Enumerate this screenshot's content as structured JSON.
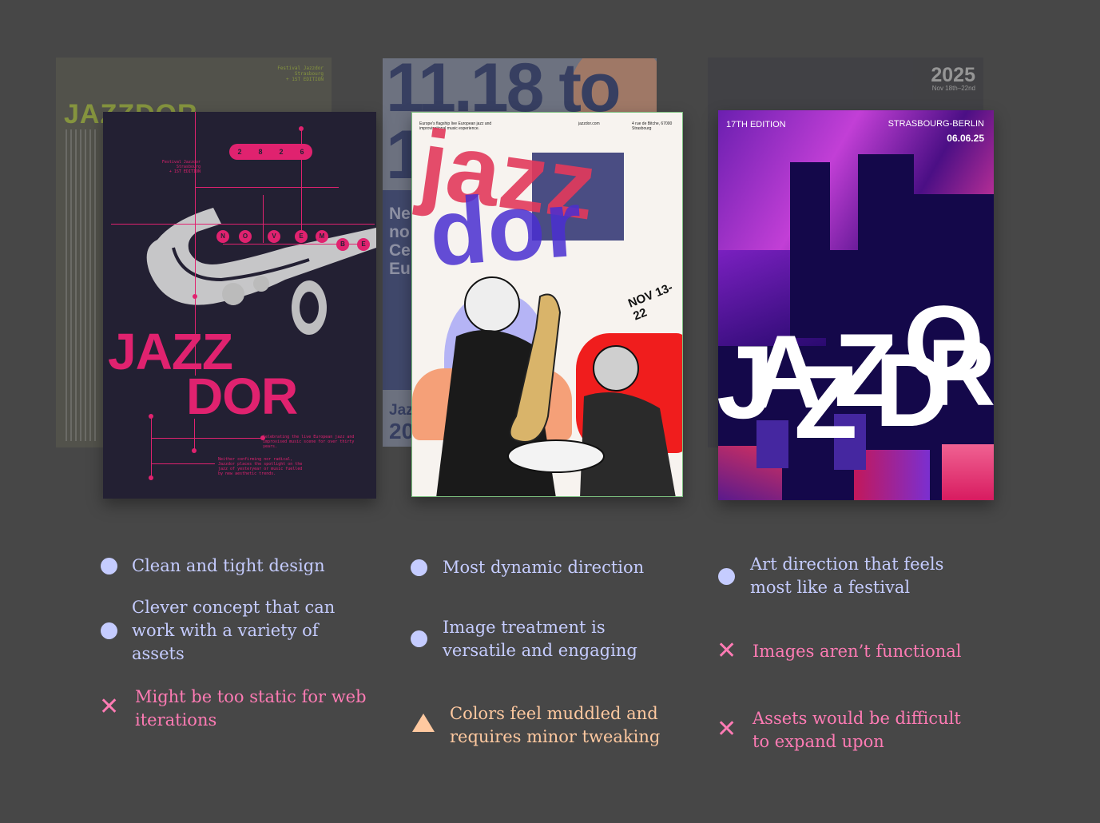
{
  "posters": {
    "back1": {
      "title": "JAZZDOR",
      "tag_lines": [
        "Festival Jazzdor",
        "Strasbourg",
        "+ 1ST EDITION"
      ]
    },
    "back2": {
      "big_date": "11.18 to",
      "big_num": "1",
      "side_text": [
        "Ne",
        "no",
        "Ce",
        "Eu"
      ],
      "bottom_text": [
        "Jaz",
        "20"
      ]
    },
    "back3": {
      "year": "2025",
      "dates": "Nov 18th–22nd"
    },
    "poster1": {
      "numbers": [
        "2",
        "8",
        "2",
        "6"
      ],
      "tag_lines": [
        "Festival Jazzdor",
        "Strasbourg",
        "+ 1ST EDITION"
      ],
      "beads": [
        "N",
        "O",
        "V",
        "E",
        "M",
        "B",
        "E"
      ],
      "title_line1": "JAZZ",
      "title_line2": "DOR",
      "body1": "Celebrating the live European jazz and improvised music scene for over thirty years.",
      "body2": "Neither confirming nor radical, Jazzdor places the spotlight on the jazz of yesteryear or music fuelled by new aesthetic trends."
    },
    "poster2": {
      "header_left": "Europe's flagship live European jazz and improvisational music experience.",
      "header_center": "jazzdor.com",
      "header_right": "4 rue de Bitche, 67000 Strasbourg",
      "word1": "jazz",
      "word2": "dor",
      "date": "NOV 13-22"
    },
    "poster3": {
      "edition": "17TH EDITION",
      "city": "STRASBOURG-BERLIN",
      "date": "06.06.25",
      "letters": [
        "J",
        "A",
        "Z",
        "Z",
        "D",
        "O",
        "R"
      ]
    }
  },
  "notes": {
    "col1": [
      {
        "kind": "pro",
        "text": "Clean and tight design"
      },
      {
        "kind": "pro",
        "text": "Clever concept that can work with a variety of assets"
      },
      {
        "kind": "con",
        "text": "Might be too static for web iterations"
      }
    ],
    "col2": [
      {
        "kind": "pro",
        "text": "Most dynamic direction"
      },
      {
        "kind": "pro",
        "text": "Image treatment is versatile and engaging"
      },
      {
        "kind": "warn",
        "text": "Colors feel muddled and requires minor tweaking"
      }
    ],
    "col3": [
      {
        "kind": "pro",
        "text": "Art direction that feels most like a festival"
      },
      {
        "kind": "con",
        "text": "Images aren’t functional"
      },
      {
        "kind": "con",
        "text": "Assets would be difficult to expand upon"
      }
    ]
  },
  "colors": {
    "pro": "#c5ccff",
    "con": "#ff7bb4",
    "warn": "#ffc9a0",
    "magenta": "#e0226f",
    "violet": "#14084a"
  }
}
